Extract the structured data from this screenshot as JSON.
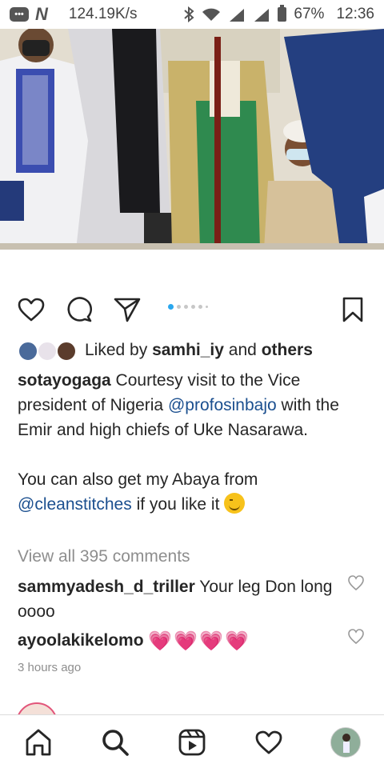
{
  "status_bar": {
    "speed": "124.19K/s",
    "battery": "67%",
    "time": "12:36",
    "notification_icons": [
      "chat-icon",
      "n-app-icon"
    ],
    "system_icons": [
      "bluetooth-icon",
      "wifi-icon",
      "signal-icon",
      "signal-icon",
      "battery-icon"
    ]
  },
  "post": {
    "image_dots": {
      "count": 6,
      "active_index": 0,
      "active_color": "#2aa7ee"
    },
    "likes": {
      "prefix": "Liked by",
      "user": "samhi_iy",
      "and": "and",
      "others": "others"
    },
    "caption": {
      "user": "sotayogaga",
      "text1": "Courtesy visit to the Vice president of Nigeria",
      "mention1": "@profosinbajo",
      "text2": "with the Emir and high chiefs of Uke Nasarawa.",
      "text3": "You can also get my Abaya from",
      "mention2": "@cleanstitches",
      "text4": "if you like it"
    },
    "view_all": "View all 395 comments",
    "comments": [
      {
        "user": "sammyadesh_d_triller",
        "text": "Your leg Don long oooo"
      },
      {
        "user": "ayoolakikelomo",
        "text": "💗💗💗💗"
      }
    ],
    "time_ago": "3 hours ago"
  },
  "colors": {
    "link": "#1b4f8f",
    "heart_emoji": "#e23a85",
    "muted": "#8e8e8e"
  },
  "bottom_nav": [
    "home-icon",
    "search-icon",
    "reels-icon",
    "heart-icon",
    "profile-avatar"
  ]
}
